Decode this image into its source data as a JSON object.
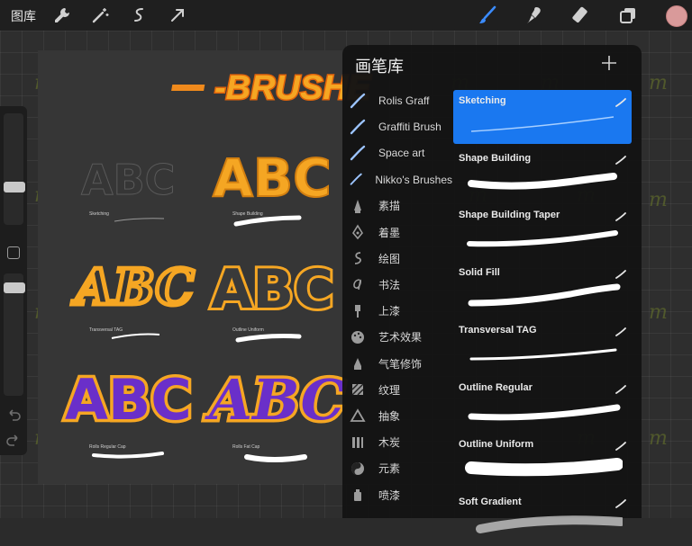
{
  "topbar": {
    "gallery_label": "图库",
    "tools": [
      "wrench-icon",
      "magic-wand-icon",
      "selection-icon",
      "transform-arrow-icon"
    ],
    "right_tools": [
      "brush-icon",
      "smudge-icon",
      "eraser-icon",
      "layers-icon"
    ],
    "active_color": "#d99a9a"
  },
  "artwork": {
    "heading": "-BRUSHE",
    "thumbnail_labels": [
      "Sketching",
      "Shape Building",
      "Transversal TAG",
      "Outline Uniform",
      "Rolls Regular Cap",
      "Rolls Fat Cap"
    ],
    "thumbnail_art": [
      "ABC",
      "ABC",
      "ABC",
      "ABC",
      "ABC",
      "ABC"
    ]
  },
  "library": {
    "title": "画笔库",
    "categories": [
      {
        "label": "Rolis Graff",
        "icon": "brush-stroke-icon"
      },
      {
        "label": "Graffiti Brush",
        "icon": "brush-stroke-icon"
      },
      {
        "label": "Space art",
        "icon": "brush-stroke-icon"
      },
      {
        "label": "Nikko's Brushes",
        "icon": "brush-stroke-icon"
      },
      {
        "label": "素描",
        "icon": "pencil-icon"
      },
      {
        "label": "着墨",
        "icon": "ink-pen-icon"
      },
      {
        "label": "绘图",
        "icon": "squiggle-icon"
      },
      {
        "label": "书法",
        "icon": "calligraphy-icon"
      },
      {
        "label": "上漆",
        "icon": "paint-brush-icon"
      },
      {
        "label": "艺术效果",
        "icon": "palette-icon"
      },
      {
        "label": "气笔修饰",
        "icon": "airbrush-icon"
      },
      {
        "label": "纹理",
        "icon": "texture-icon"
      },
      {
        "label": "抽象",
        "icon": "triangle-icon"
      },
      {
        "label": "木炭",
        "icon": "charcoal-icon"
      },
      {
        "label": "元素",
        "icon": "yin-yang-icon"
      },
      {
        "label": "喷漆",
        "icon": "spray-can-icon"
      }
    ],
    "brushes": [
      {
        "name": "Sketching",
        "selected": true
      },
      {
        "name": "Shape Building",
        "selected": false
      },
      {
        "name": "Shape Building Taper",
        "selected": false
      },
      {
        "name": "Solid Fill",
        "selected": false
      },
      {
        "name": "Transversal TAG",
        "selected": false
      },
      {
        "name": "Outline Regular",
        "selected": false
      },
      {
        "name": "Outline Uniform",
        "selected": false
      },
      {
        "name": "Soft Gradient",
        "selected": false
      }
    ]
  },
  "watermark": "m",
  "colors": {
    "accent_blue": "#1a78f0",
    "graffiti_orange": "#f5a623",
    "graffiti_purple": "#6a2fc9"
  }
}
